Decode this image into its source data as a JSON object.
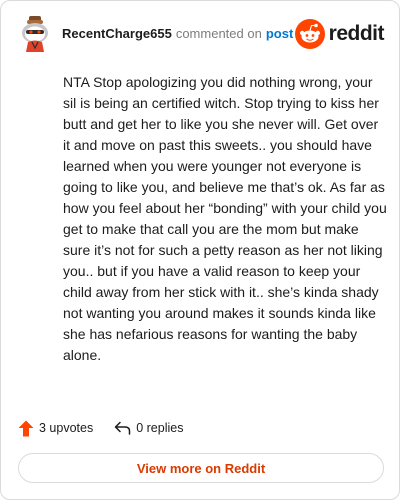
{
  "comment": {
    "username": "RecentCharge655",
    "action_text": "commented on",
    "post_link_label": "post",
    "body": "NTA Stop apologizing you did nothing wrong, your sil is being an certified witch. Stop trying to kiss her butt and get her to like you she never will. Get over it and move on past this sweets.. you should have learned when you were younger not everyone is going to like you, and believe me that’s ok. As far as how you feel about her “bonding” with your child you get to make that call you are the mom but make sure it’s not for such a petty reason as her not liking you.. but if you have a valid reason to keep your child away from her stick with it.. she’s kinda shady not wanting you around makes it sounds kinda like she has nefarious reasons for wanting the baby alone."
  },
  "brand": {
    "wordmark": "reddit",
    "icon": "reddit-snoo-icon",
    "color": "#ff4500"
  },
  "footer": {
    "upvotes_label": "3 upvotes",
    "upvote_icon": "upvote-arrow-icon",
    "upvote_color": "#ff4500",
    "replies_label": "0 replies",
    "reply_icon": "reply-arrow-icon"
  },
  "cta": {
    "label": "View more on Reddit",
    "color": "#d93a00"
  },
  "colors": {
    "link": "#0079d3",
    "muted": "#7c7c7c",
    "text": "#1c1c1c"
  }
}
